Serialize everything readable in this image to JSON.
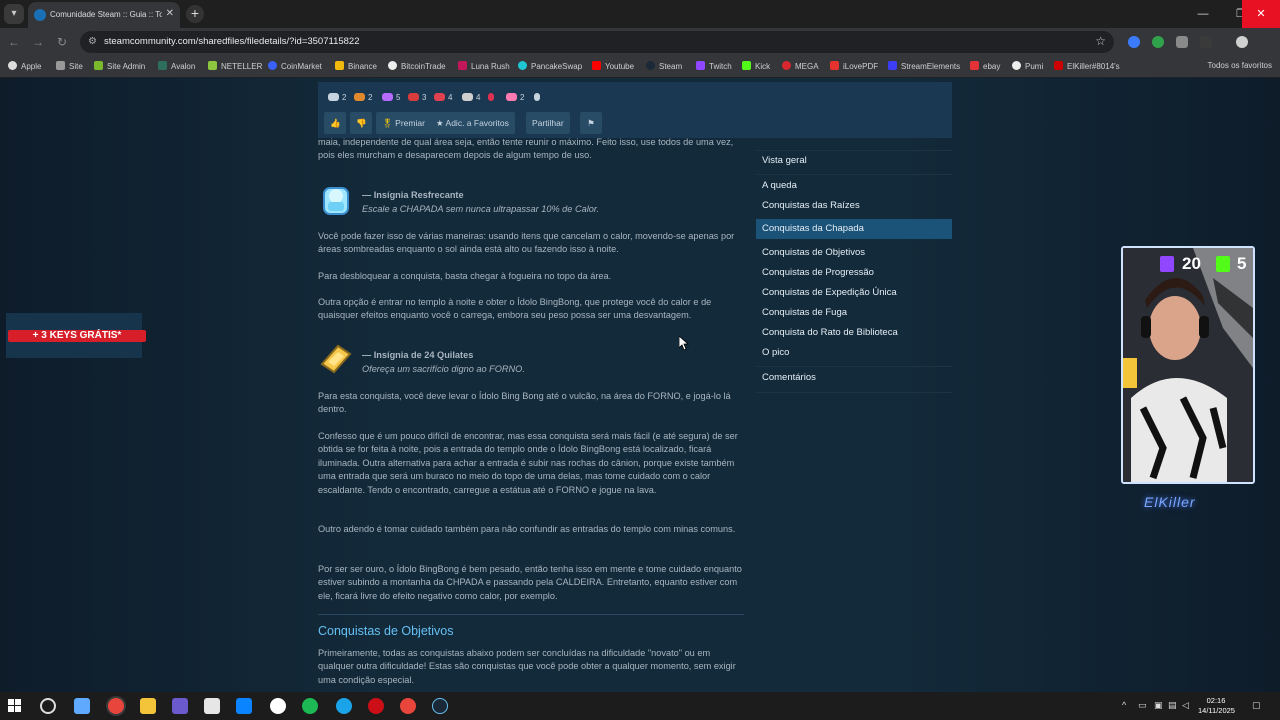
{
  "browser": {
    "tab_title": "Comunidade Steam :: Guia :: To",
    "url": "steamcommunity.com/sharedfiles/filedetails/?id=3507115822",
    "bookmarks": [
      "Apple",
      "Site",
      "Site Admin",
      "Avalon",
      "NETELLER",
      "CoinMarket",
      "Binance",
      "BitcoinTrade",
      "Luna Rush",
      "PancakeSwap",
      "Youtube",
      "Steam",
      "Twitch",
      "Kick",
      "MEGA",
      "iLovePDF",
      "StreamElements",
      "ebay",
      "Pumi",
      "ElKiller#8014's"
    ],
    "all_bookmarks_label": "Todos os favoritos"
  },
  "award_bar": {
    "awards": [
      "2",
      "2",
      "5",
      "3",
      "4",
      "4",
      "",
      "2",
      ""
    ],
    "buttons": {
      "premiar": "Premiar",
      "favoritos": "Adic. a Favoritos",
      "partilhar": "Partilhar"
    }
  },
  "guide": {
    "top_text": "maia, independente de qual área seja, então tente reunir o máximo. Feito isso, use todos de uma vez, pois eles murcham e desaparecem depois de algum tempo de uso.",
    "ach1": {
      "title": "— Insígnia Resfrecante",
      "desc": "Escale a CHAPADA sem nunca ultrapassar 10% de Calor."
    },
    "ach1_p1": "Você pode fazer isso de várias maneiras: usando itens que cancelam o calor, movendo-se apenas por áreas sombreadas enquanto o sol ainda está alto ou fazendo isso à noite.",
    "ach1_p2": "Para desbloquear a conquista, basta chegar à fogueira no topo da área.",
    "ach1_p3": "Outra opção é entrar no templo à noite e obter o Ídolo BingBong, que protege você do calor e de quaisquer efeitos enquanto você o carrega, embora seu peso possa ser uma desvantagem.",
    "ach2": {
      "title": "— Insígnia de 24 Quilates",
      "desc": "Ofereça um sacrifício digno ao FORNO."
    },
    "ach2_p1": "Para esta conquista, você deve levar o Ídolo Bing Bong até o vulcão, na área do FORNO, e jogá-lo lá dentro.",
    "ach2_p2": "Confesso que é um pouco difícil de encontrar, mas essa conquista será mais fácil (e até segura) de ser obtida se for feita à noite, pois a entrada do templo onde o Ídolo BingBong está localizado, ficará iluminada. Outra alternativa para achar a entrada é subir nas rochas do cânion, porque existe também uma entrada que será um buraco no meio do topo de uma delas, mas tome cuidado com o calor escaldante. Tendo o encontrado, carregue a estátua até o FORNO e jogue na lava.",
    "ach2_p3": "Outro adendo é tomar cuidado também para não confundir as entradas do templo com minas comuns.",
    "ach2_p4": "Por ser ser ouro, o Ídolo BingBong é bem pesado, então tenha isso em mente e tome cuidado enquanto estiver subindo a montanha da CHPADA e passando pela CALDEIRA. Entretanto, equanto estiver com ele, ficará livre do efeito negativo como calor, por exemplo.",
    "section_title": "Conquistas de Objetivos",
    "section_p1": "Primeiramente, todas as conquistas abaixo podem ser concluídas na dificuldade \"novato\" ou em qualquer outra dificuldade! Estas são conquistas que você pode obter a qualquer momento, sem exigir uma condição especial."
  },
  "sidenav": {
    "items": [
      "Vista geral",
      "A queda",
      "Conquistas das Raízes",
      "Conquistas da Chapada",
      "Conquistas de Objetivos",
      "Conquistas de Progressão",
      "Conquistas de Expedição Única",
      "Conquistas de Fuga",
      "Conquista do Rato de Biblioteca",
      "O pico",
      "Comentários"
    ],
    "active_index": 3
  },
  "promo": {
    "label": "+ 3 KEYS GRÁTIS*"
  },
  "stream_overlay": {
    "twitch_count": "20",
    "kick_count": "5",
    "signature": "ElKiller"
  },
  "taskbar": {
    "time": "02:16",
    "date": "14/11/2025"
  },
  "colors": {
    "steam_link": "#66c0f4",
    "active_nav": "#1b5278",
    "promo_red": "#d71f2a",
    "kick_green": "#53fc18",
    "twitch_purple": "#9146ff"
  }
}
